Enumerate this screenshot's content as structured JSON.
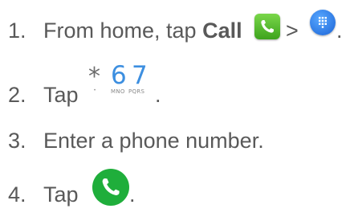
{
  "steps": [
    {
      "number": "1.",
      "text_before": "From home, tap ",
      "bold": "Call",
      "separator": ">",
      "trailing": ".",
      "icons": [
        "call-app-icon",
        "dial-keypad-icon"
      ]
    },
    {
      "number": "2.",
      "text_before": "Tap",
      "trailing": ".",
      "keypad": {
        "star": "*",
        "digits": [
          "6",
          "7"
        ],
        "letters": [
          "MNO",
          "PQRS"
        ]
      }
    },
    {
      "number": "3.",
      "text": "Enter a phone number."
    },
    {
      "number": "4.",
      "text_before": "Tap",
      "trailing": ".",
      "icons": [
        "green-call-button-icon"
      ]
    }
  ],
  "colors": {
    "text": "#595959",
    "call_green": "#1fae3b",
    "dial_blue": "#1b63d6",
    "digit_blue": "#3d8fe0"
  }
}
